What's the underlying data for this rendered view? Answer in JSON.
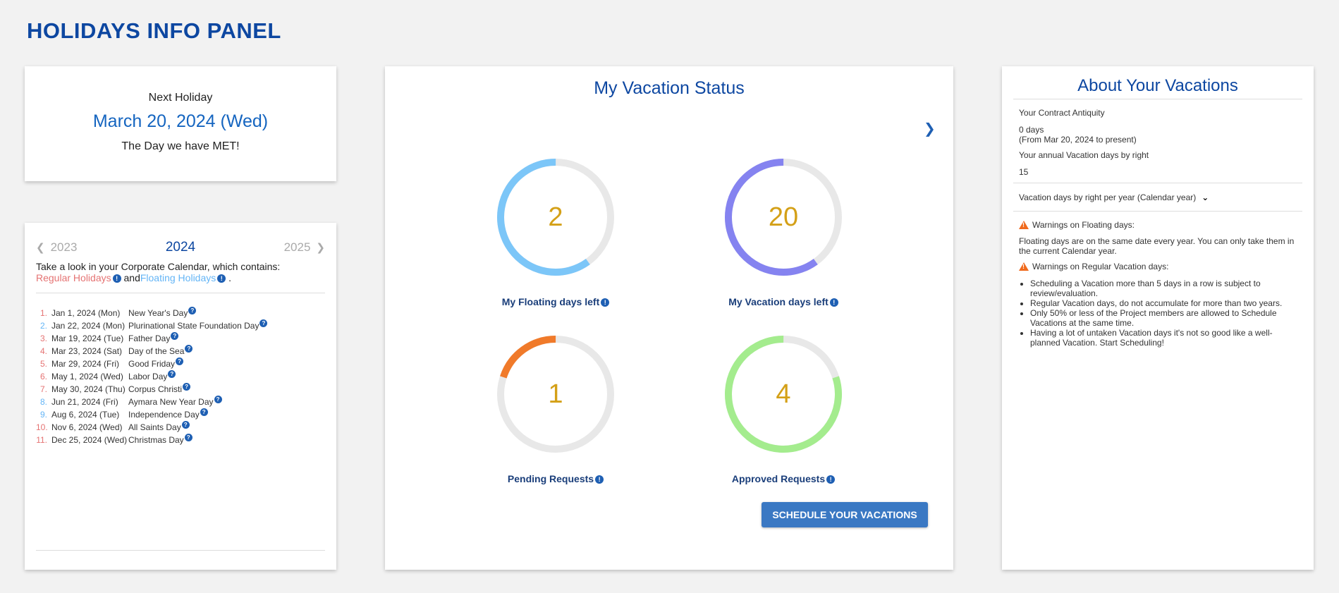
{
  "page": {
    "title": "HOLIDAYS INFO PANEL"
  },
  "next_holiday": {
    "label": "Next Holiday",
    "date": "March 20, 2024 (Wed)",
    "name": "The Day we have MET!"
  },
  "calendar": {
    "prev_year": "2023",
    "current_year": "2024",
    "next_year": "2025",
    "intro_text": "Take a look in your Corporate Calendar, which contains:",
    "regular_label": "Regular Holidays",
    "and_text": " and",
    "floating_label": "Floating Holidays",
    "period": " .",
    "holidays": [
      {
        "num": "1.",
        "date": "Jan 1, 2024 (Mon)",
        "name": "New Year's Day",
        "type": "regular"
      },
      {
        "num": "2.",
        "date": "Jan 22, 2024 (Mon)",
        "name": "Plurinational State Foundation Day",
        "type": "floating"
      },
      {
        "num": "3.",
        "date": "Mar 19, 2024 (Tue)",
        "name": "Father Day",
        "type": "regular"
      },
      {
        "num": "4.",
        "date": "Mar 23, 2024 (Sat)",
        "name": "Day of the Sea",
        "type": "regular"
      },
      {
        "num": "5.",
        "date": "Mar 29, 2024 (Fri)",
        "name": "Good Friday",
        "type": "regular"
      },
      {
        "num": "6.",
        "date": "May 1, 2024 (Wed)",
        "name": "Labor Day",
        "type": "regular"
      },
      {
        "num": "7.",
        "date": "May 30, 2024 (Thu)",
        "name": "Corpus Christi",
        "type": "regular"
      },
      {
        "num": "8.",
        "date": "Jun 21, 2024 (Fri)",
        "name": "Aymara New Year Day",
        "type": "floating"
      },
      {
        "num": "9.",
        "date": "Aug 6, 2024 (Tue)",
        "name": "Independence Day",
        "type": "floating"
      },
      {
        "num": "10.",
        "date": "Nov 6, 2024 (Wed)",
        "name": "All Saints Day",
        "type": "regular"
      },
      {
        "num": "11.",
        "date": "Dec 25, 2024 (Wed)",
        "name": "Christmas Day",
        "type": "regular"
      }
    ]
  },
  "vacation_status": {
    "title": "My Vacation Status",
    "rings": [
      {
        "id": "floating",
        "value": "2",
        "label": "My Floating days left",
        "fraction": 0.6,
        "color": "#7cc6f8"
      },
      {
        "id": "vacation",
        "value": "20",
        "label": "My Vacation days left",
        "fraction": 0.6,
        "color": "#8583f0"
      },
      {
        "id": "pending",
        "value": "1",
        "label": "Pending Requests",
        "fraction": 0.2,
        "color": "#f07a2a"
      },
      {
        "id": "approved",
        "value": "4",
        "label": "Approved Requests",
        "fraction": 0.8,
        "color": "#a4ec8e"
      }
    ],
    "ring_track_color": "#e8e8e8",
    "schedule_button": "SCHEDULE YOUR VACATIONS"
  },
  "about": {
    "title": "About Your Vacations",
    "antiquity_label": "Your Contract Antiquity",
    "antiquity_value": "0 days",
    "antiquity_since": "(From Mar 20, 2024 to present)",
    "annual_label": "Your annual Vacation days by right",
    "annual_value": "15",
    "per_year_label": "Vacation days by right per year (Calendar year)",
    "warn_floating_title": "Warnings on Floating days:",
    "warn_floating_text": "Floating days are on the same date every year. You can only take them in the current Calendar year.",
    "warn_regular_title": "Warnings on Regular Vacation days:",
    "warn_regular_items": [
      "Scheduling a Vacation more than 5 days in a row is subject to review/evaluation.",
      "Regular Vacation days, do not accumulate for more than two years.",
      "Only 50% or less of the Project members are allowed to Schedule Vacations at the same time.",
      "Having a lot of untaken Vacation days it's not so good like a well-planned Vacation. Start Scheduling!"
    ]
  }
}
